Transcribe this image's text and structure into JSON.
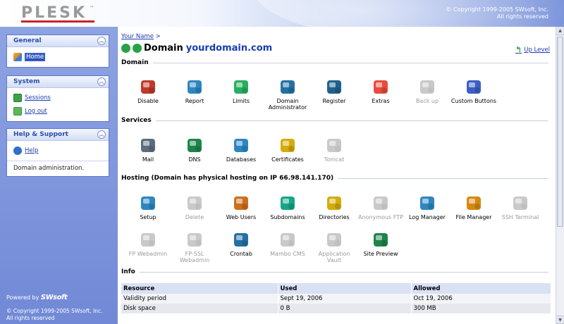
{
  "header": {
    "logo": "PLESK",
    "logo_tm": "™",
    "copyright_line1": "© Copyright 1999-2005 SWsoft, Inc.",
    "copyright_line2": "All rights reserved"
  },
  "sidebar": {
    "general": {
      "title": "General",
      "items": [
        {
          "label": "Home",
          "icon": "home-icon"
        }
      ]
    },
    "system": {
      "title": "System",
      "items": [
        {
          "label": "Sessions",
          "icon": "sessions-icon"
        },
        {
          "label": "Log out",
          "icon": "logout-icon"
        }
      ]
    },
    "help": {
      "title": "Help & Support",
      "items": [
        {
          "label": "Help",
          "icon": "help-icon"
        }
      ],
      "description": "Domain administration."
    },
    "powered_by": "Powered by",
    "powered_brand": "SWsoft",
    "copyright_line1": "© Copyright 1999-2005 SWsoft, Inc.",
    "copyright_line2": "All rights reserved"
  },
  "main": {
    "breadcrumb": "Your Name",
    "breadcrumb_sep": ">",
    "title_prefix": "Domain",
    "title_domain": "yourdomain.com",
    "up_level": "Up Level",
    "sections": {
      "domain": {
        "title": "Domain",
        "tools": [
          {
            "label": "Disable",
            "icon": "disable-icon",
            "enabled": true,
            "color": "#c0392b"
          },
          {
            "label": "Report",
            "icon": "report-icon",
            "enabled": true,
            "color": "#2e86c1"
          },
          {
            "label": "Limits",
            "icon": "limits-icon",
            "enabled": true,
            "color": "#27ae60"
          },
          {
            "label": "Domain Administrator",
            "icon": "domain-administrator-icon",
            "enabled": true,
            "color": "#2471a3"
          },
          {
            "label": "Register",
            "icon": "register-icon",
            "enabled": true,
            "color": "#1f618d"
          },
          {
            "label": "Extras",
            "icon": "extras-icon",
            "enabled": true,
            "color": "#e74c3c"
          },
          {
            "label": "Back up",
            "icon": "backup-icon",
            "enabled": false,
            "color": "#888888"
          },
          {
            "label": "Custom Buttons",
            "icon": "custom-buttons-icon",
            "enabled": true,
            "color": "#3d5fc4"
          }
        ]
      },
      "services": {
        "title": "Services",
        "tools": [
          {
            "label": "Mail",
            "icon": "mail-icon",
            "enabled": true,
            "color": "#5d6d7e"
          },
          {
            "label": "DNS",
            "icon": "dns-icon",
            "enabled": true,
            "color": "#1e8449"
          },
          {
            "label": "Databases",
            "icon": "databases-icon",
            "enabled": true,
            "color": "#2e86c1"
          },
          {
            "label": "Certificates",
            "icon": "certificates-icon",
            "enabled": true,
            "color": "#d4ac0d"
          },
          {
            "label": "Tomcat",
            "icon": "tomcat-icon",
            "enabled": false,
            "color": "#888888"
          }
        ]
      },
      "hosting": {
        "title": "Hosting (Domain has physical hosting on IP 66.98.141.170)",
        "row1": [
          {
            "label": "Setup",
            "icon": "setup-icon",
            "enabled": true,
            "color": "#2e86c1"
          },
          {
            "label": "Delete",
            "icon": "delete-icon",
            "enabled": false,
            "color": "#888888"
          },
          {
            "label": "Web Users",
            "icon": "web-users-icon",
            "enabled": true,
            "color": "#ca6f1e"
          },
          {
            "label": "Subdomains",
            "icon": "subdomains-icon",
            "enabled": true,
            "color": "#17a589"
          },
          {
            "label": "Directories",
            "icon": "directories-icon",
            "enabled": true,
            "color": "#d4ac0d"
          },
          {
            "label": "Anonymous FTP",
            "icon": "anonymous-ftp-icon",
            "enabled": false,
            "color": "#888888"
          },
          {
            "label": "Log Manager",
            "icon": "log-manager-icon",
            "enabled": true,
            "color": "#2e86c1"
          },
          {
            "label": "File Manager",
            "icon": "file-manager-icon",
            "enabled": true,
            "color": "#d68910"
          },
          {
            "label": "SSH Terminal",
            "icon": "ssh-terminal-icon",
            "enabled": false,
            "color": "#888888"
          }
        ],
        "row2": [
          {
            "label": "FP Webadmin",
            "icon": "fp-webadmin-icon",
            "enabled": false,
            "color": "#888888"
          },
          {
            "label": "FP-SSL Webadmin",
            "icon": "fp-ssl-webadmin-icon",
            "enabled": false,
            "color": "#888888"
          },
          {
            "label": "Crontab",
            "icon": "crontab-icon",
            "enabled": true,
            "color": "#2471a3"
          },
          {
            "label": "Mambo CMS",
            "icon": "mambo-cms-icon",
            "enabled": false,
            "color": "#888888"
          },
          {
            "label": "Application Vault",
            "icon": "application-vault-icon",
            "enabled": false,
            "color": "#888888"
          },
          {
            "label": "Site Preview",
            "icon": "site-preview-icon",
            "enabled": true,
            "color": "#1e8449"
          }
        ]
      },
      "info": {
        "title": "Info",
        "columns": [
          "Resource",
          "Used",
          "Allowed"
        ],
        "rows": [
          [
            "Validity period",
            "Sept 19, 2006",
            "Oct 19, 2006"
          ],
          [
            "Disk space",
            "0 B",
            "300 MB"
          ]
        ]
      }
    }
  }
}
